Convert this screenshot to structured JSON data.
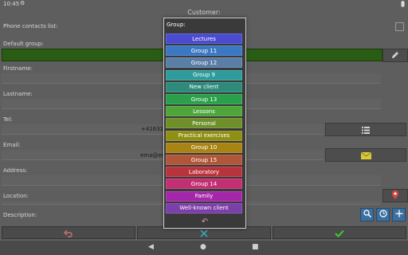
{
  "status_bar": {
    "time": "10:45",
    "settings_icon": "gear-icon",
    "battery_icon": "battery-icon"
  },
  "header": {
    "title": "Customer:"
  },
  "form": {
    "phone_contacts_label": "Phone contacts list:",
    "default_group_label": "Default group:",
    "firstname_label": "Firstname:",
    "lastname_label": "Lastname:",
    "tel_label": "Tel:",
    "tel_value": "+41631",
    "email_label": "Email:",
    "email_value": "ema@en",
    "address_label": "Address:",
    "location_label": "Location:",
    "description_label": "Description:"
  },
  "popup": {
    "title": "Group:",
    "items": [
      {
        "label": "Lectures",
        "color": "#4b4bd0"
      },
      {
        "label": "Group 11",
        "color": "#3b78c4"
      },
      {
        "label": "Group 12",
        "color": "#5a7ea8"
      },
      {
        "label": "Group 9",
        "color": "#2f9b9b"
      },
      {
        "label": "New client",
        "color": "#2e8a7a"
      },
      {
        "label": "Group 13",
        "color": "#2aa04a"
      },
      {
        "label": "Lessons",
        "color": "#4ea63a"
      },
      {
        "label": "Personal",
        "color": "#6e8f2a"
      },
      {
        "label": "Practical exercises",
        "color": "#8f8f14"
      },
      {
        "label": "Group 10",
        "color": "#a98414"
      },
      {
        "label": "Group 15",
        "color": "#b0573a"
      },
      {
        "label": "Laboratory",
        "color": "#b8343c"
      },
      {
        "label": "Group 14",
        "color": "#c22f72"
      },
      {
        "label": "Family",
        "color": "#a327a8"
      },
      {
        "label": "Well-known client",
        "color": "#7c3ea8"
      }
    ],
    "undo_icon": "undo-arrow-icon"
  },
  "colors": {
    "default_group_bar": "#2a5d14",
    "confirm_check": "#39d02a"
  },
  "icons": {
    "edit": "pencil-icon",
    "contacts_list": "list-icon",
    "email": "envelope-icon",
    "location": "map-pin-icon",
    "search": "search-icon",
    "timer": "timer-icon",
    "add": "plus-icon",
    "back": "undo-arrow-icon",
    "cancel": "close-icon",
    "confirm": "check-icon"
  }
}
